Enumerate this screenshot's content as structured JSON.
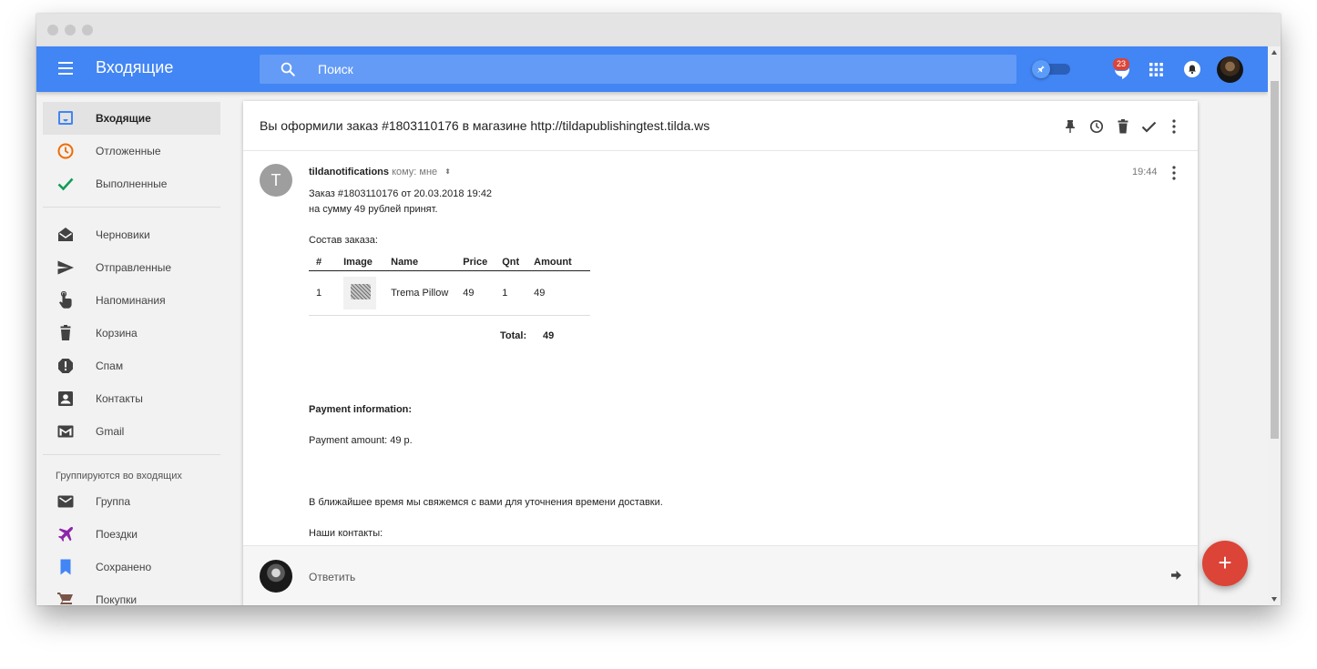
{
  "appbar": {
    "title": "Входящие",
    "search_placeholder": "Поиск",
    "notification_count": "23"
  },
  "sidebar": {
    "items": [
      {
        "label": "Входящие",
        "icon": "inbox-icon",
        "color": "#4285f4"
      },
      {
        "label": "Отложенные",
        "icon": "clock-icon",
        "color": "#ef6c00"
      },
      {
        "label": "Выполненные",
        "icon": "check-icon",
        "color": "#0f9d58"
      },
      {
        "label": "Черновики",
        "icon": "drafts-icon",
        "color": "#424242"
      },
      {
        "label": "Отправленные",
        "icon": "send-icon",
        "color": "#424242"
      },
      {
        "label": "Напоминания",
        "icon": "reminder-hand-icon",
        "color": "#424242"
      },
      {
        "label": "Корзина",
        "icon": "trash-icon",
        "color": "#424242"
      },
      {
        "label": "Спам",
        "icon": "spam-icon",
        "color": "#424242"
      },
      {
        "label": "Контакты",
        "icon": "contacts-icon",
        "color": "#424242"
      },
      {
        "label": "Gmail",
        "icon": "gmail-icon",
        "color": "#424242"
      }
    ],
    "group_heading": "Группируются во входящих",
    "group_items": [
      {
        "label": "Группа",
        "icon": "group-mail-icon",
        "color": "#424242"
      },
      {
        "label": "Поездки",
        "icon": "airplane-icon",
        "color": "#8e24aa"
      },
      {
        "label": "Сохранено",
        "icon": "bookmark-icon",
        "color": "#4285f4"
      },
      {
        "label": "Покупки",
        "icon": "cart-icon",
        "color": "#795548"
      }
    ]
  },
  "email": {
    "subject": "Вы оформили заказ #1803110176 в магазине http://tildapublishingtest.tilda.ws",
    "avatar_letter": "T",
    "sender": "tildanotifications",
    "recipient": "кому: мне",
    "time": "19:44",
    "body": {
      "line1": "Заказ #1803110176 от 20.03.2018 19:42",
      "line2": "на сумму 49 рублей принят.",
      "order_heading": "Состав заказа:",
      "table_headers": [
        "#",
        "Image",
        "Name",
        "Price",
        "Qnt",
        "Amount"
      ],
      "rows": [
        {
          "num": "1",
          "name": "Trema Pillow",
          "price": "49",
          "qnt": "1",
          "amount": "49"
        }
      ],
      "total_label": "Total:",
      "total_value": "49",
      "payment_heading": "Payment information:",
      "payment_amount": "Payment amount: 49 р.",
      "delivery_note": "В ближайшее время мы свяжемся с вами для уточнения времени доставки.",
      "contacts_heading": "Наши контакты:"
    }
  },
  "reply": {
    "label": "Ответить"
  },
  "colors": {
    "appbar": "#4285f4",
    "fab": "#db4437",
    "badge": "#db4437"
  }
}
